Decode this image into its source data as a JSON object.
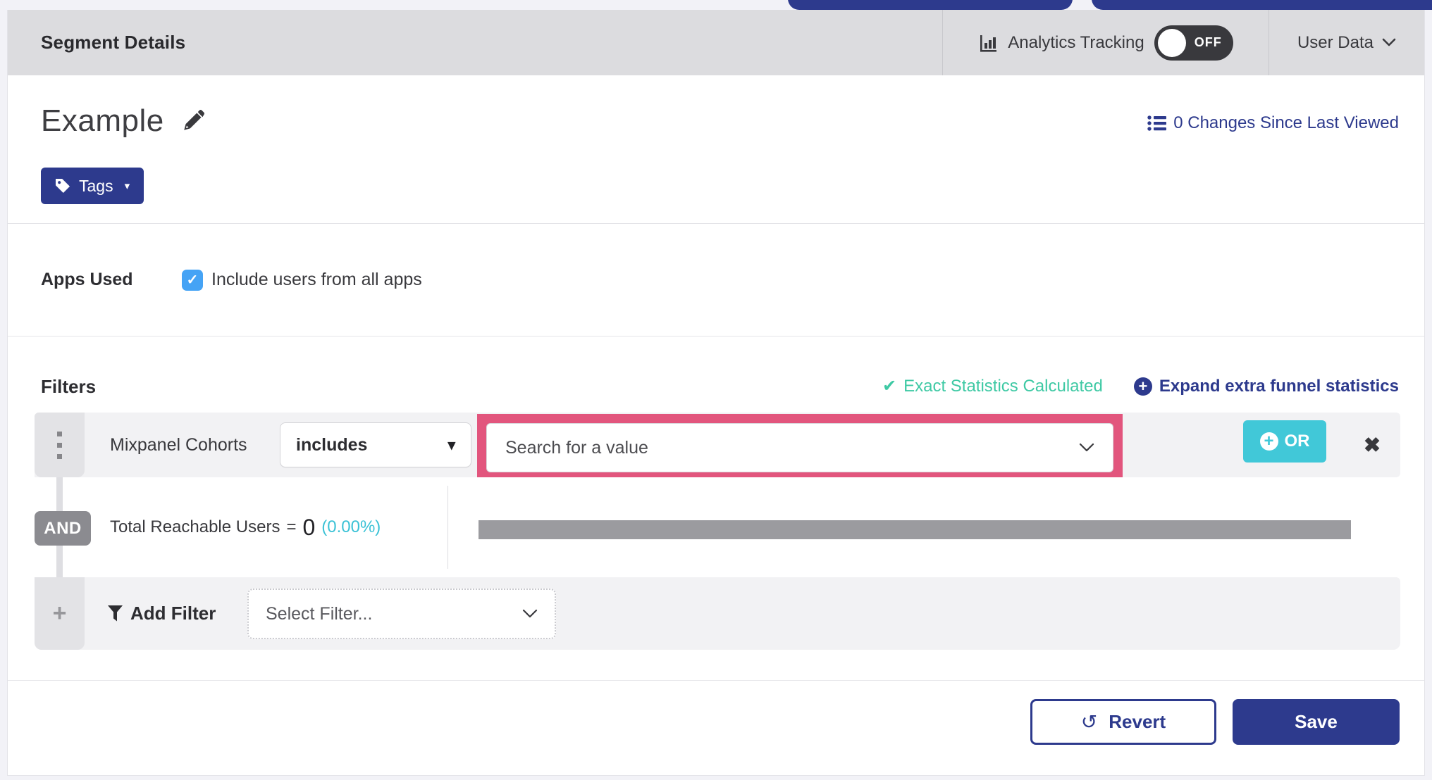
{
  "header": {
    "title": "Segment Details",
    "analytics_label": "Analytics Tracking",
    "toggle_state": "OFF",
    "user_data_label": "User Data"
  },
  "segment": {
    "name": "Example",
    "changes_link": "0 Changes Since Last Viewed",
    "tags_label": "Tags"
  },
  "apps_used": {
    "label": "Apps Used",
    "checkbox_label": "Include users from all apps",
    "checked": true
  },
  "filters": {
    "heading": "Filters",
    "exact_stats": "Exact Statistics Calculated",
    "expand_link": "Expand extra funnel statistics",
    "row": {
      "name": "Mixpanel Cohorts",
      "operator": "includes",
      "value_placeholder": "Search for a value",
      "or_label": "OR"
    },
    "and_label": "AND",
    "reachable": {
      "label": "Total Reachable Users",
      "equals": "=",
      "value": "0",
      "percent": "(0.00%)"
    },
    "add_filter": {
      "label": "Add Filter",
      "select_placeholder": "Select Filter..."
    }
  },
  "footer": {
    "revert": "Revert",
    "save": "Save"
  },
  "icons": {
    "check": "✔",
    "close": "✖",
    "caret_down": "▾",
    "plus": "+",
    "undo": "↺",
    "checkbox_check": "✓"
  },
  "colors": {
    "indigo": "#2d3a8d",
    "teal_button": "#41c8d8",
    "mint_green": "#3ec9a4",
    "highlight_pink": "#e2557d",
    "percent_cyan": "#3bc2d6",
    "checkbox_blue": "#45a3f5",
    "bar_gray": "#9b9b9f"
  }
}
